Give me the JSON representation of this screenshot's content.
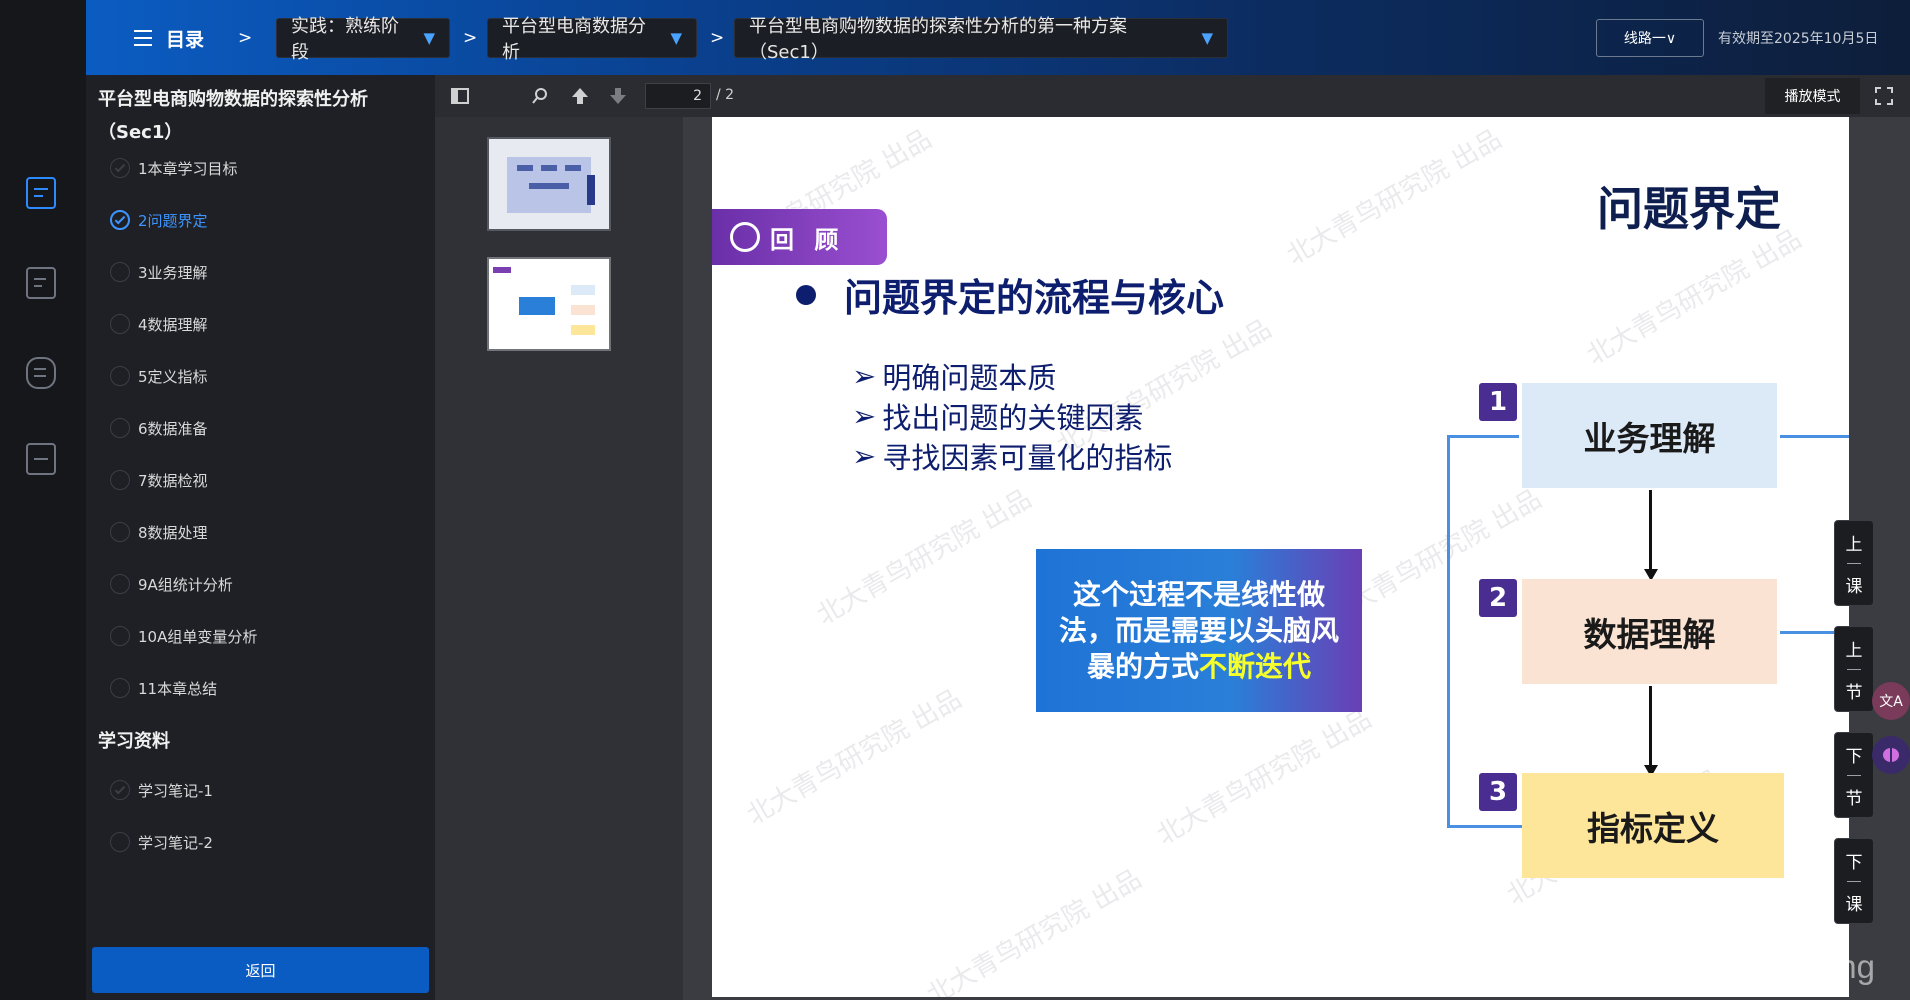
{
  "header": {
    "toc_label": "目录",
    "sep": ">",
    "crumbs": [
      "实践：熟练阶段",
      "平台型电商数据分析",
      "平台型电商购物数据的探索性分析的第一种方案（Sec1）"
    ],
    "crumb_caret": "▼",
    "route_label": "线路一∨",
    "valid_text": "有效期至2025年10月5日"
  },
  "sidebar": {
    "title": "平台型电商购物数据的探索性分析（Sec1）",
    "items": [
      "1本章学习目标",
      "2问题界定",
      "3业务理解",
      "4数据理解",
      "5定义指标",
      "6数据准备",
      "7数据检视",
      "8数据处理",
      "9A组统计分析",
      "10A组单变量分析",
      "11本章总结"
    ],
    "current_index": 1,
    "materials_title": "学习资料",
    "materials": [
      "学习笔记-1",
      "学习笔记-2"
    ],
    "back_label": "返回"
  },
  "viewer": {
    "page_current": "2",
    "page_total": "/ 2",
    "play_mode_label": "播放模式"
  },
  "slide": {
    "title": "问题界定",
    "review_label": "回 顾",
    "main_point": "问题界定的流程与核心",
    "sub_points": [
      "明确问题本质",
      "找出问题的关键因素",
      "寻找因素可量化的指标"
    ],
    "sub_marker": "➢",
    "callout_text": "这个过程不是线性做法，而是需要以头脑风暴的方式",
    "callout_highlight": "不断迭代",
    "flow": [
      {
        "num": "1",
        "label": "业务理解",
        "color": "#dce9f7"
      },
      {
        "num": "2",
        "label": "数据理解",
        "color": "#fbe3d3"
      },
      {
        "num": "3",
        "label": "指标定义",
        "color": "#fde59a"
      }
    ],
    "watermark": "北大青鸟研究院 出品"
  },
  "side_nav": [
    {
      "top": "上",
      "bottom": "课"
    },
    {
      "top": "上",
      "bottom": "节"
    },
    {
      "top": "下",
      "bottom": "节"
    },
    {
      "top": "下",
      "bottom": "课"
    }
  ],
  "side_float": {
    "translate_label": "文A"
  },
  "footer_watermark": "CSDN @Waiting"
}
